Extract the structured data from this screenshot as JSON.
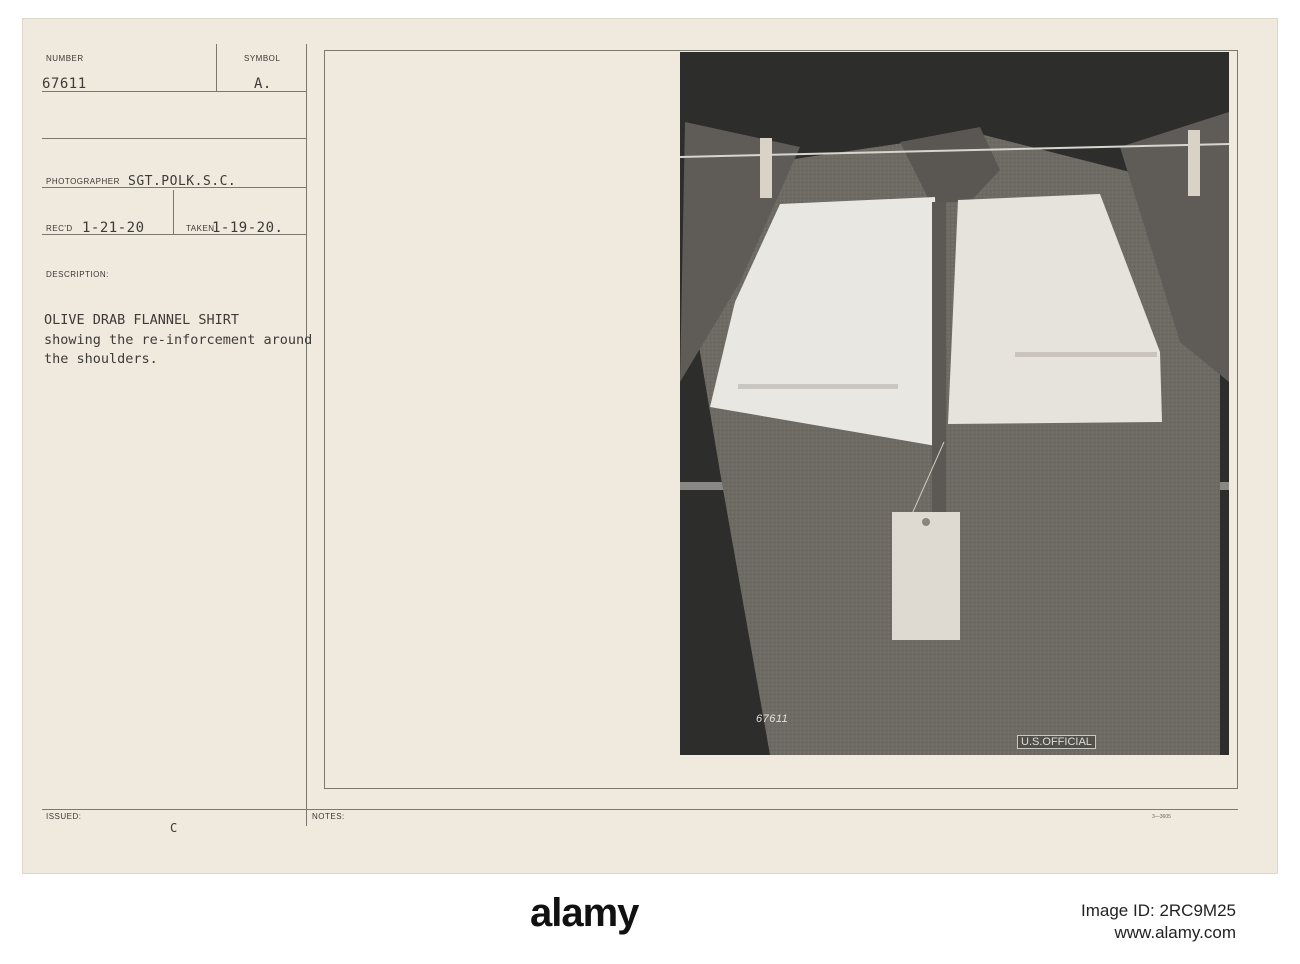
{
  "card": {
    "number_label": "NUMBER",
    "number": "67611",
    "symbol_label": "SYMBOL",
    "symbol": "A.",
    "photographer_label": "PHOTOGRAPHER",
    "photographer": "SGT.POLK.S.C.",
    "recd_label": "REC'D",
    "recd": "1-21-20",
    "taken_label": "TAKEN",
    "taken": "1-19-20.",
    "description_label": "DESCRIPTION:",
    "description_lines": [
      "OLIVE DRAB FLANNEL SHIRT",
      "showing the re-inforcement around",
      "the shoulders."
    ],
    "issued_label": "ISSUED:",
    "issued": "C",
    "notes_label": "NOTES:",
    "form_code": "3—3605"
  },
  "photo": {
    "negative_number": "67611",
    "stamp": "U.S.OFFICIAL"
  },
  "footer": {
    "brand": "alamy",
    "image_id_label": "Image ID:",
    "image_id": "2RC9M25",
    "website": "www.alamy.com"
  },
  "colors": {
    "card_bg": "#efe9de",
    "ink": "#3d3b37",
    "photo_bg": "#2d2d2b",
    "fabric": "#6e6b65",
    "reinforcement": "#e9e7e1"
  }
}
